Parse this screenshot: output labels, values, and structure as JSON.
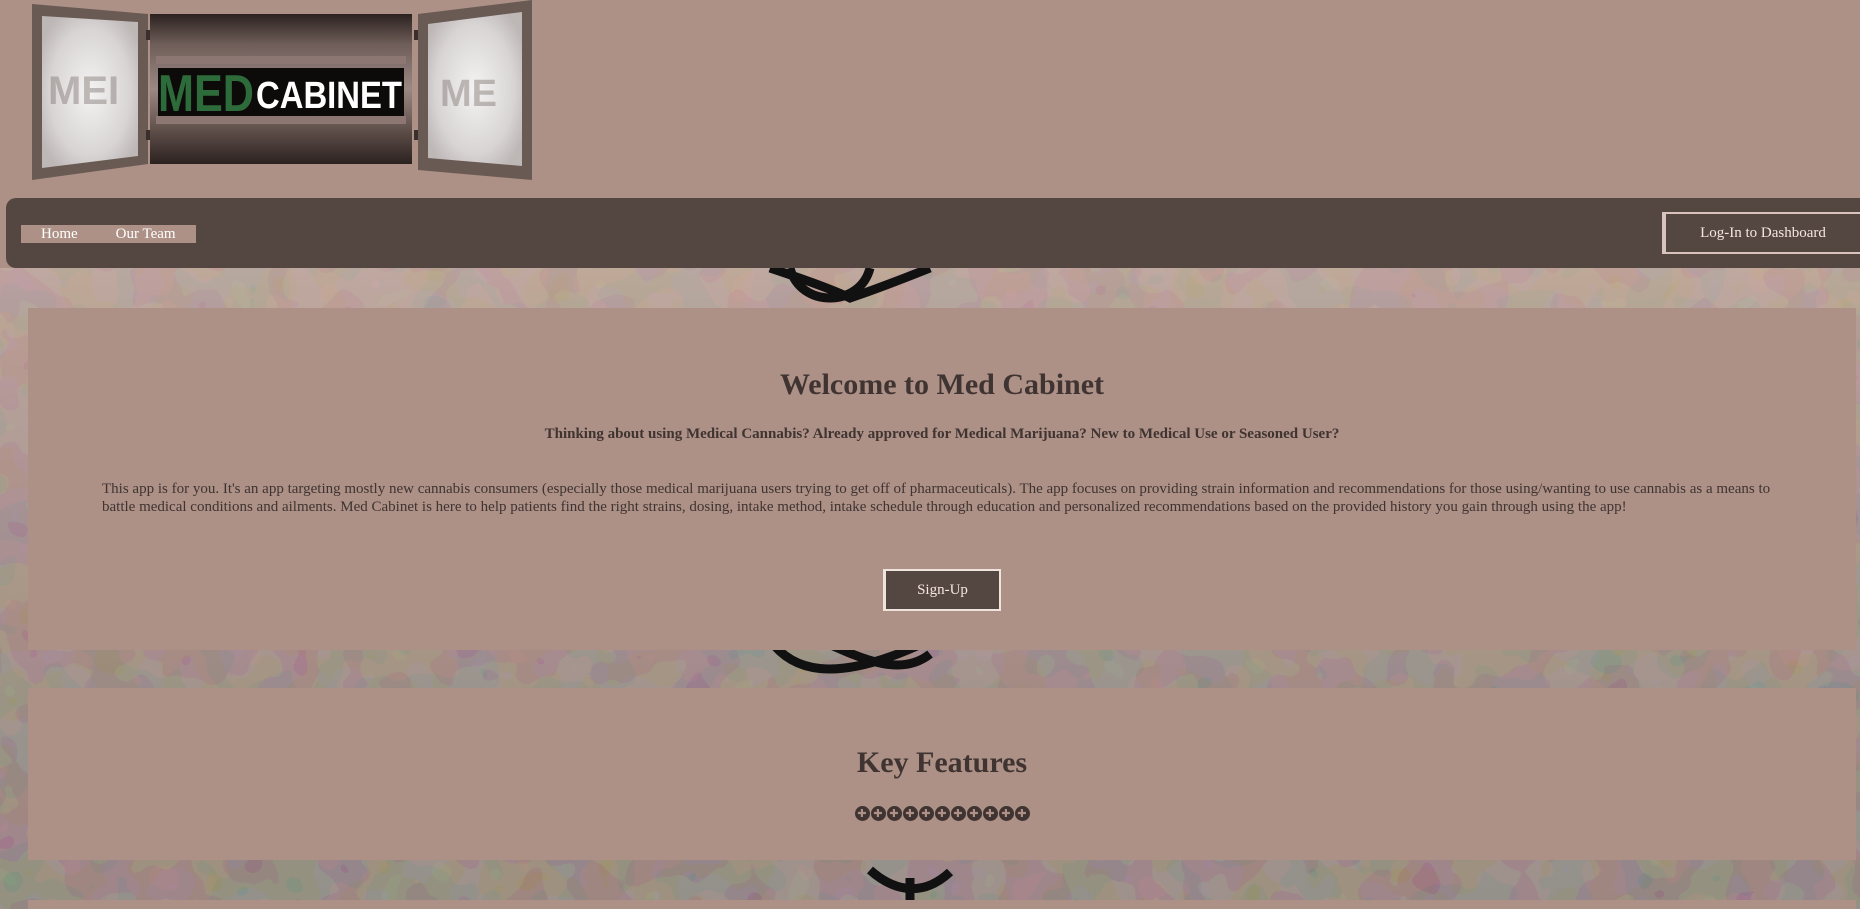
{
  "header": {
    "logo_text_med": "MED",
    "logo_text_cabinet": "CABINET",
    "logo_ghost_left": "MEI",
    "logo_ghost_right": "ME"
  },
  "nav": {
    "links": [
      "Home",
      "Our Team"
    ],
    "login_label": "Log-In to Dashboard"
  },
  "welcome": {
    "title": "Welcome to Med Cabinet",
    "subtitle": "Thinking about using Medical Cannabis? Already approved for Medical Marijuana? New to Medical Use or Seasoned User?",
    "body": "This app is for you. It's an app targeting mostly new cannabis consumers (especially those medical marijuana users trying to get off of pharmaceuticals). The app focuses on providing strain information and recommendations for those using/wanting to use cannabis as a means to battle medical conditions and ailments. Med Cabinet is here to help patients find the right strains, dosing, intake method, intake schedule through education and personalized recommendations based on the provided history you gain through using the app!",
    "signup_label": "Sign-Up"
  },
  "features": {
    "title": "Key Features",
    "dot_count": 11,
    "dot_glyph": "✚"
  },
  "colors": {
    "page_bg": "#ad9086",
    "nav_bg": "#544640",
    "text": "#3f3431",
    "logo_green": "#2e6b3a"
  }
}
